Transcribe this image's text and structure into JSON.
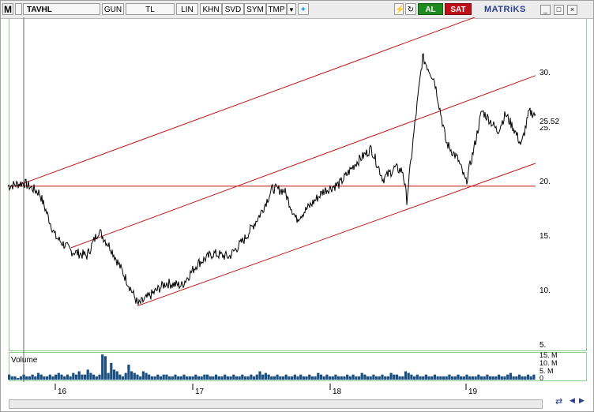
{
  "toolbar": {
    "m_label": "M",
    "symbol": "TAVHL",
    "period": "GUN",
    "currency": "TL",
    "scale": "LIN",
    "buttons": [
      "KHN",
      "SVD",
      "SYM",
      "TMP"
    ],
    "al_label": "AL",
    "sat_label": "SAT",
    "brand": "MATRiKS"
  },
  "price_axis": {
    "ticks": [
      "30.",
      "25.",
      "20.",
      "15.",
      "10.",
      "5."
    ],
    "current_price": "25.52"
  },
  "volume": {
    "title": "Volume",
    "ticks": [
      "15. M",
      "10. M",
      "5. M",
      "0"
    ]
  },
  "x_axis": {
    "labels": [
      "16",
      "17",
      "18",
      "19"
    ]
  },
  "colors": {
    "price_line": "#000000",
    "channel_line": "#c21818",
    "volume_bars": "#1a4f80",
    "panel_border": "#8fcf8f"
  },
  "chart_data": {
    "type": "line",
    "ylim": [
      5,
      34
    ],
    "yticks": [
      5,
      10,
      15,
      20,
      25,
      30
    ],
    "horizontal_line": 19.2,
    "series": [
      {
        "points": [
          [
            0,
            19.2
          ],
          [
            20,
            19.5
          ],
          [
            40,
            18.6
          ],
          [
            60,
            14.8
          ],
          [
            80,
            13.5
          ],
          [
            100,
            13.1
          ],
          [
            115,
            15.3
          ],
          [
            130,
            13.8
          ],
          [
            150,
            11.0
          ],
          [
            165,
            8.8
          ],
          [
            180,
            9.6
          ],
          [
            200,
            10.7
          ],
          [
            220,
            10.5
          ],
          [
            240,
            12.4
          ],
          [
            260,
            13.3
          ],
          [
            280,
            13.0
          ],
          [
            300,
            14.6
          ],
          [
            320,
            16.8
          ],
          [
            335,
            19.0
          ],
          [
            350,
            18.8
          ],
          [
            365,
            16.3
          ],
          [
            380,
            17.3
          ],
          [
            400,
            18.8
          ],
          [
            420,
            19.4
          ],
          [
            440,
            21.2
          ],
          [
            460,
            22.5
          ],
          [
            475,
            19.8
          ],
          [
            490,
            20.8
          ],
          [
            500,
            20.5
          ],
          [
            505,
            18.0
          ],
          [
            515,
            24.5
          ],
          [
            525,
            30.5
          ],
          [
            540,
            28.5
          ],
          [
            555,
            23.0
          ],
          [
            570,
            21.5
          ],
          [
            580,
            19.5
          ],
          [
            590,
            22.5
          ],
          [
            600,
            25.8
          ],
          [
            610,
            25.0
          ],
          [
            620,
            24.0
          ],
          [
            630,
            25.5
          ],
          [
            640,
            24.3
          ],
          [
            650,
            22.8
          ],
          [
            660,
            25.7
          ],
          [
            668,
            25.52
          ]
        ]
      }
    ],
    "channel_lines": [
      {
        "from": [
          10,
          19.2
        ],
        "to": [
          630,
          35.0
        ]
      },
      {
        "from": [
          80,
          13.8
        ],
        "to": [
          676,
          29.1
        ]
      },
      {
        "from": [
          164,
          8.7
        ],
        "to": [
          676,
          21.4
        ]
      }
    ],
    "volume_bars": [
      3,
      2,
      2,
      1,
      2,
      3,
      2,
      2,
      3,
      2,
      4,
      3,
      2,
      2,
      3,
      2,
      3,
      4,
      3,
      2,
      3,
      2,
      4,
      3,
      5,
      3,
      3,
      6,
      4,
      3,
      2,
      3,
      15,
      14,
      4,
      10,
      6,
      5,
      3,
      2,
      4,
      9,
      5,
      4,
      3,
      2,
      5,
      4,
      3,
      2,
      2,
      3,
      2,
      3,
      3,
      2,
      2,
      3,
      2,
      2,
      3,
      2,
      2,
      2,
      3,
      2,
      2,
      3,
      3,
      2,
      2,
      3,
      2,
      2,
      3,
      2,
      2,
      3,
      2,
      2,
      3,
      2,
      2,
      3,
      2,
      3,
      5,
      3,
      4,
      3,
      2,
      2,
      3,
      2,
      2,
      3,
      2,
      2,
      3,
      2,
      3,
      2,
      2,
      3,
      2,
      2,
      4,
      3,
      2,
      3,
      2,
      2,
      3,
      2,
      2,
      2,
      3,
      2,
      3,
      2,
      2,
      4,
      3,
      2,
      2,
      3,
      2,
      2,
      3,
      2,
      2,
      4,
      3,
      3,
      2,
      2,
      5,
      4,
      3,
      2,
      3,
      2,
      2,
      3,
      2,
      2,
      3,
      2,
      2,
      2,
      2,
      3,
      2,
      2,
      3,
      2,
      2,
      3,
      2,
      2,
      2,
      3,
      2,
      2,
      3,
      2,
      2,
      2,
      3,
      2,
      2,
      3,
      4,
      2,
      2,
      3,
      2,
      2,
      3,
      2,
      3
    ]
  }
}
